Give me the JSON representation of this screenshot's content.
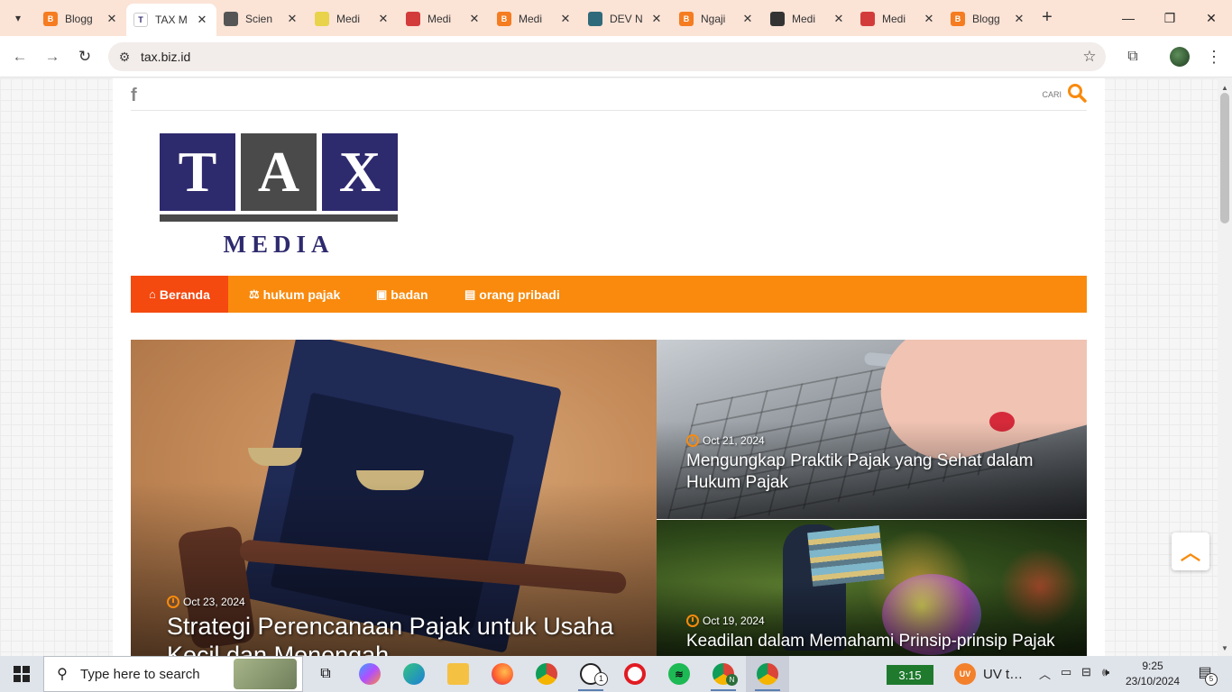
{
  "browser": {
    "tabs": [
      {
        "title": "Blogg",
        "favicon_color": "#f57c20",
        "active": false
      },
      {
        "title": "TAX M",
        "favicon_color": "#2e2a6e",
        "active": true
      },
      {
        "title": "Scien",
        "favicon_color": "#555555",
        "active": false
      },
      {
        "title": "Medi",
        "favicon_color": "#e8d34a",
        "active": false
      },
      {
        "title": "Medi",
        "favicon_color": "#d33b3b",
        "active": false
      },
      {
        "title": "Medi",
        "favicon_color": "#f57c20",
        "active": false
      },
      {
        "title": "DEV N",
        "favicon_color": "#2f6a7a",
        "active": false
      },
      {
        "title": "Ngaji",
        "favicon_color": "#f57c20",
        "active": false
      },
      {
        "title": "Medi",
        "favicon_color": "#333333",
        "active": false
      },
      {
        "title": "Medi",
        "favicon_color": "#d33b3b",
        "active": false
      },
      {
        "title": "Blogg",
        "favicon_color": "#f57c20",
        "active": false
      }
    ],
    "url": "tax.biz.id",
    "tab_favicon_icon": "page-favicon-icon",
    "tab_close_icon": "close-icon"
  },
  "site": {
    "search_label": "CARI",
    "logo": {
      "letters": [
        "T",
        "A",
        "X"
      ],
      "subtitle": "MEDIA"
    },
    "nav": [
      {
        "label": "Beranda",
        "icon": "home-icon",
        "glyph": "⌂",
        "active": true
      },
      {
        "label": "hukum pajak",
        "icon": "scale-icon",
        "glyph": "⚖",
        "active": false
      },
      {
        "label": "badan",
        "icon": "id-card-icon",
        "glyph": "▣",
        "active": false
      },
      {
        "label": "orang pribadi",
        "icon": "contact-card-icon",
        "glyph": "▤",
        "active": false
      }
    ],
    "posts": [
      {
        "date": "Oct 23, 2024",
        "title": "Strategi Perencanaan Pajak untuk Usaha Kecil dan Menengah"
      },
      {
        "date": "Oct 21, 2024",
        "title": "Mengungkap Praktik Pajak yang Sehat dalam Hukum Pajak"
      },
      {
        "date": "Oct 19, 2024",
        "title": "Keadilan dalam Memahami Prinsip-prinsip Pajak"
      }
    ],
    "colors": {
      "accent": "#f98a0d",
      "active_nav": "#f4490f",
      "logo_blue": "#2e2a6e"
    }
  },
  "taskbar": {
    "search_placeholder": "Type here to search",
    "battery": "3:15",
    "uv_text": "UV t…",
    "uv_badge": "UV",
    "time": "9:25",
    "date": "23/10/2024",
    "notification_count": "5",
    "whatsapp_badge": "1",
    "chrome_profile_badge": "N"
  }
}
